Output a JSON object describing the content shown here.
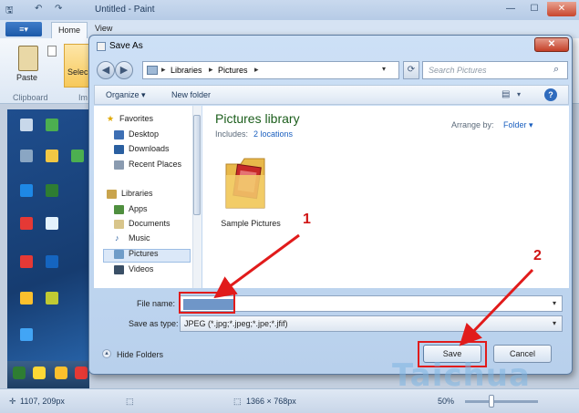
{
  "paint": {
    "title": "Untitled - Paint",
    "quick_access": [
      "🖫",
      "↶",
      "↷"
    ],
    "window_buttons": [
      "—",
      "☐",
      "✕"
    ],
    "tabs": [
      "Home",
      "View"
    ],
    "paint_button": "≡▾",
    "paste_label": "Paste",
    "clipboard_group": "Clipboard",
    "select_label": "Selec",
    "image_group_abbr": "Im",
    "status": {
      "cursor_pos": "1107, 209px",
      "dimensions": "1366 × 768px",
      "zoom": "50%"
    }
  },
  "dialog": {
    "title": "Save As",
    "close_glyph": "✕",
    "nav_back_glyph": "◀",
    "nav_forward_glyph": "▶",
    "breadcrumbs": [
      "Libraries",
      "Pictures"
    ],
    "breadcrumb_sep": "▸",
    "search_placeholder": "Search Pictures",
    "organize": "Organize ▾",
    "new_folder": "New folder",
    "help_glyph": "?",
    "nav": {
      "favorites": "Favorites",
      "desktop": "Desktop",
      "downloads": "Downloads",
      "recent_places": "Recent Places",
      "libraries": "Libraries",
      "apps": "Apps",
      "documents": "Documents",
      "music": "Music",
      "pictures": "Pictures",
      "videos": "Videos"
    },
    "library_title": "Pictures library",
    "includes_label": "Includes:",
    "includes_link": "2 locations",
    "arrange_label": "Arrange by:",
    "arrange_value": "Folder ▾",
    "folder_item": "Sample Pictures",
    "file_name_label": "File name:",
    "file_name_value": "",
    "save_as_type_label": "Save as type:",
    "save_as_type_value": "JPEG (*.jpg;*.jpeg;*.jpe;*.jfif)",
    "hide_folders": "Hide Folders",
    "save_button": "Save",
    "cancel_button": "Cancel"
  },
  "annotations": {
    "step1": "1",
    "step2": "2",
    "color": "#e11b1b"
  },
  "watermark": "Taichua"
}
